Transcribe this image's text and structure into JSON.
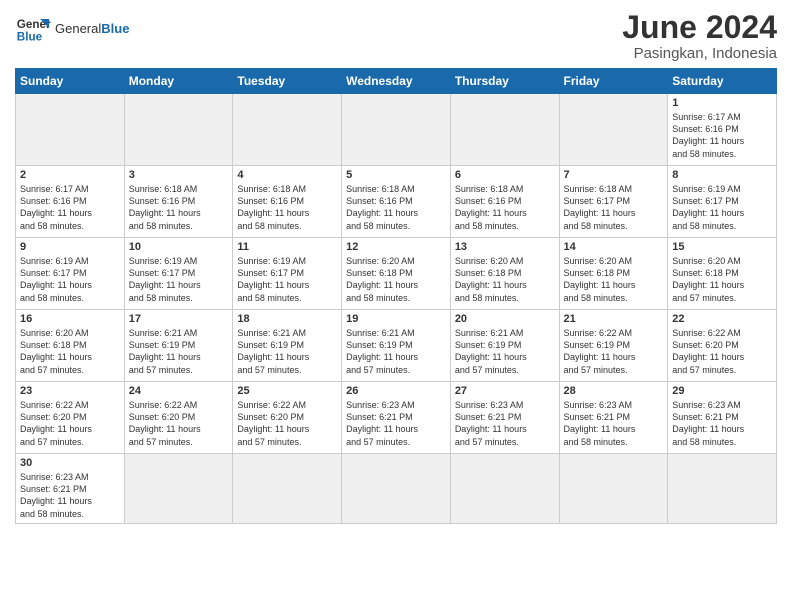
{
  "header": {
    "logo_general": "General",
    "logo_blue": "Blue",
    "month_year": "June 2024",
    "location": "Pasingkan, Indonesia"
  },
  "days_of_week": [
    "Sunday",
    "Monday",
    "Tuesday",
    "Wednesday",
    "Thursday",
    "Friday",
    "Saturday"
  ],
  "weeks": [
    [
      {
        "day": "",
        "info": "",
        "empty": true
      },
      {
        "day": "",
        "info": "",
        "empty": true
      },
      {
        "day": "",
        "info": "",
        "empty": true
      },
      {
        "day": "",
        "info": "",
        "empty": true
      },
      {
        "day": "",
        "info": "",
        "empty": true
      },
      {
        "day": "",
        "info": "",
        "empty": true
      },
      {
        "day": "1",
        "info": "Sunrise: 6:17 AM\nSunset: 6:16 PM\nDaylight: 11 hours\nand 58 minutes."
      }
    ],
    [
      {
        "day": "2",
        "info": "Sunrise: 6:17 AM\nSunset: 6:16 PM\nDaylight: 11 hours\nand 58 minutes."
      },
      {
        "day": "3",
        "info": "Sunrise: 6:18 AM\nSunset: 6:16 PM\nDaylight: 11 hours\nand 58 minutes."
      },
      {
        "day": "4",
        "info": "Sunrise: 6:18 AM\nSunset: 6:16 PM\nDaylight: 11 hours\nand 58 minutes."
      },
      {
        "day": "5",
        "info": "Sunrise: 6:18 AM\nSunset: 6:16 PM\nDaylight: 11 hours\nand 58 minutes."
      },
      {
        "day": "6",
        "info": "Sunrise: 6:18 AM\nSunset: 6:16 PM\nDaylight: 11 hours\nand 58 minutes."
      },
      {
        "day": "7",
        "info": "Sunrise: 6:18 AM\nSunset: 6:17 PM\nDaylight: 11 hours\nand 58 minutes."
      },
      {
        "day": "8",
        "info": "Sunrise: 6:19 AM\nSunset: 6:17 PM\nDaylight: 11 hours\nand 58 minutes."
      }
    ],
    [
      {
        "day": "9",
        "info": "Sunrise: 6:19 AM\nSunset: 6:17 PM\nDaylight: 11 hours\nand 58 minutes."
      },
      {
        "day": "10",
        "info": "Sunrise: 6:19 AM\nSunset: 6:17 PM\nDaylight: 11 hours\nand 58 minutes."
      },
      {
        "day": "11",
        "info": "Sunrise: 6:19 AM\nSunset: 6:17 PM\nDaylight: 11 hours\nand 58 minutes."
      },
      {
        "day": "12",
        "info": "Sunrise: 6:20 AM\nSunset: 6:18 PM\nDaylight: 11 hours\nand 58 minutes."
      },
      {
        "day": "13",
        "info": "Sunrise: 6:20 AM\nSunset: 6:18 PM\nDaylight: 11 hours\nand 58 minutes."
      },
      {
        "day": "14",
        "info": "Sunrise: 6:20 AM\nSunset: 6:18 PM\nDaylight: 11 hours\nand 58 minutes."
      },
      {
        "day": "15",
        "info": "Sunrise: 6:20 AM\nSunset: 6:18 PM\nDaylight: 11 hours\nand 57 minutes."
      }
    ],
    [
      {
        "day": "16",
        "info": "Sunrise: 6:20 AM\nSunset: 6:18 PM\nDaylight: 11 hours\nand 57 minutes."
      },
      {
        "day": "17",
        "info": "Sunrise: 6:21 AM\nSunset: 6:19 PM\nDaylight: 11 hours\nand 57 minutes."
      },
      {
        "day": "18",
        "info": "Sunrise: 6:21 AM\nSunset: 6:19 PM\nDaylight: 11 hours\nand 57 minutes."
      },
      {
        "day": "19",
        "info": "Sunrise: 6:21 AM\nSunset: 6:19 PM\nDaylight: 11 hours\nand 57 minutes."
      },
      {
        "day": "20",
        "info": "Sunrise: 6:21 AM\nSunset: 6:19 PM\nDaylight: 11 hours\nand 57 minutes."
      },
      {
        "day": "21",
        "info": "Sunrise: 6:22 AM\nSunset: 6:19 PM\nDaylight: 11 hours\nand 57 minutes."
      },
      {
        "day": "22",
        "info": "Sunrise: 6:22 AM\nSunset: 6:20 PM\nDaylight: 11 hours\nand 57 minutes."
      }
    ],
    [
      {
        "day": "23",
        "info": "Sunrise: 6:22 AM\nSunset: 6:20 PM\nDaylight: 11 hours\nand 57 minutes."
      },
      {
        "day": "24",
        "info": "Sunrise: 6:22 AM\nSunset: 6:20 PM\nDaylight: 11 hours\nand 57 minutes."
      },
      {
        "day": "25",
        "info": "Sunrise: 6:22 AM\nSunset: 6:20 PM\nDaylight: 11 hours\nand 57 minutes."
      },
      {
        "day": "26",
        "info": "Sunrise: 6:23 AM\nSunset: 6:21 PM\nDaylight: 11 hours\nand 57 minutes."
      },
      {
        "day": "27",
        "info": "Sunrise: 6:23 AM\nSunset: 6:21 PM\nDaylight: 11 hours\nand 57 minutes."
      },
      {
        "day": "28",
        "info": "Sunrise: 6:23 AM\nSunset: 6:21 PM\nDaylight: 11 hours\nand 58 minutes."
      },
      {
        "day": "29",
        "info": "Sunrise: 6:23 AM\nSunset: 6:21 PM\nDaylight: 11 hours\nand 58 minutes."
      }
    ],
    [
      {
        "day": "30",
        "info": "Sunrise: 6:23 AM\nSunset: 6:21 PM\nDaylight: 11 hours\nand 58 minutes."
      },
      {
        "day": "",
        "info": "",
        "empty": true
      },
      {
        "day": "",
        "info": "",
        "empty": true
      },
      {
        "day": "",
        "info": "",
        "empty": true
      },
      {
        "day": "",
        "info": "",
        "empty": true
      },
      {
        "day": "",
        "info": "",
        "empty": true
      },
      {
        "day": "",
        "info": "",
        "empty": true
      }
    ]
  ]
}
